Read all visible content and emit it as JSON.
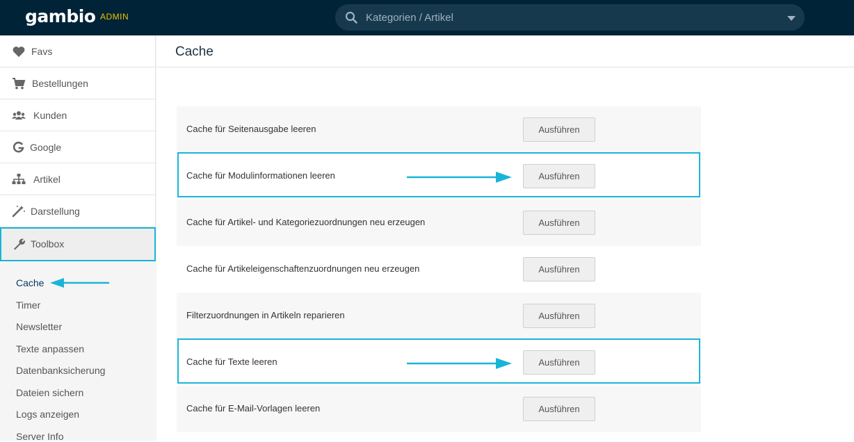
{
  "header": {
    "logo": "gambio",
    "admin_tag": "ADMIN",
    "search": {
      "placeholder": "Kategorien / Artikel",
      "icon": "search-icon",
      "dropdown_icon": "caret-down-icon"
    }
  },
  "sidebar": {
    "items": [
      {
        "label": "Favs",
        "icon": "heart-icon"
      },
      {
        "label": "Bestellungen",
        "icon": "cart-icon"
      },
      {
        "label": "Kunden",
        "icon": "users-icon"
      },
      {
        "label": "Google",
        "icon": "google-icon"
      },
      {
        "label": "Artikel",
        "icon": "sitemap-icon"
      },
      {
        "label": "Darstellung",
        "icon": "magic-wand-icon"
      },
      {
        "label": "Toolbox",
        "icon": "wrench-icon",
        "active": true
      }
    ],
    "subitems": [
      {
        "label": "Cache",
        "active": true
      },
      {
        "label": "Timer"
      },
      {
        "label": "Newsletter"
      },
      {
        "label": "Texte anpassen"
      },
      {
        "label": "Datenbanksicherung"
      },
      {
        "label": "Dateien sichern"
      },
      {
        "label": "Logs anzeigen"
      },
      {
        "label": "Server Info"
      }
    ]
  },
  "main": {
    "title": "Cache",
    "rows": [
      {
        "label": "Cache für Seitenausgabe leeren",
        "button": "Ausführen"
      },
      {
        "label": "Cache für Modulinformationen leeren",
        "button": "Ausführen",
        "highlighted": true
      },
      {
        "label": "Cache für Artikel- und Kategoriezuordnungen neu erzeugen",
        "button": "Ausführen"
      },
      {
        "label": "Cache für Artikeleigenschaftenzuordnungen neu erzeugen",
        "button": "Ausführen"
      },
      {
        "label": "Filterzuordnungen in Artikeln reparieren",
        "button": "Ausführen"
      },
      {
        "label": "Cache für Texte leeren",
        "button": "Ausführen",
        "highlighted": true
      },
      {
        "label": "Cache für E-Mail-Vorlagen leeren",
        "button": "Ausführen"
      }
    ]
  },
  "colors": {
    "topbar": "#002337",
    "accent": "#19b5d8",
    "admin_tag": "#f2c200"
  }
}
